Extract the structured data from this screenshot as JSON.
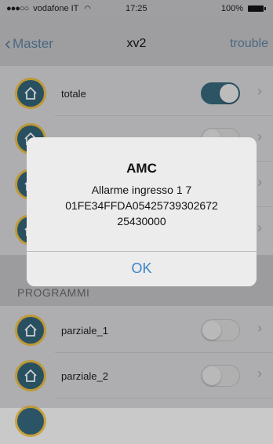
{
  "status_bar": {
    "carrier": "vodafone IT",
    "signal_dots": "●●●○○",
    "time": "17:25",
    "battery": "100%"
  },
  "nav": {
    "back_label": "Master",
    "title": "xv2",
    "right_label": "trouble"
  },
  "scenarios": [
    {
      "label": "totale",
      "on": true
    },
    {
      "label": "",
      "on": false
    },
    {
      "label": "",
      "on": false
    },
    {
      "label": "",
      "on": false
    }
  ],
  "section_header": "PROGRAMMI",
  "programs": [
    {
      "label": "parziale_1",
      "on": false
    },
    {
      "label": "parziale_2",
      "on": false
    }
  ],
  "alert": {
    "title": "AMC",
    "message_line1": "Allarme ingresso 1 7",
    "message_line2": "01FE34FFDA05425739302672",
    "message_line3": "25430000",
    "ok_label": "OK"
  },
  "colors": {
    "accent": "#3d83c7",
    "icon_bg": "#2b5567",
    "icon_ring": "#c9a23b",
    "toggle_on": "#2f5a6a"
  },
  "icons": [
    "home-icon",
    "chevron-right-icon",
    "back-chevron-icon",
    "wifi-icon",
    "battery-icon"
  ]
}
